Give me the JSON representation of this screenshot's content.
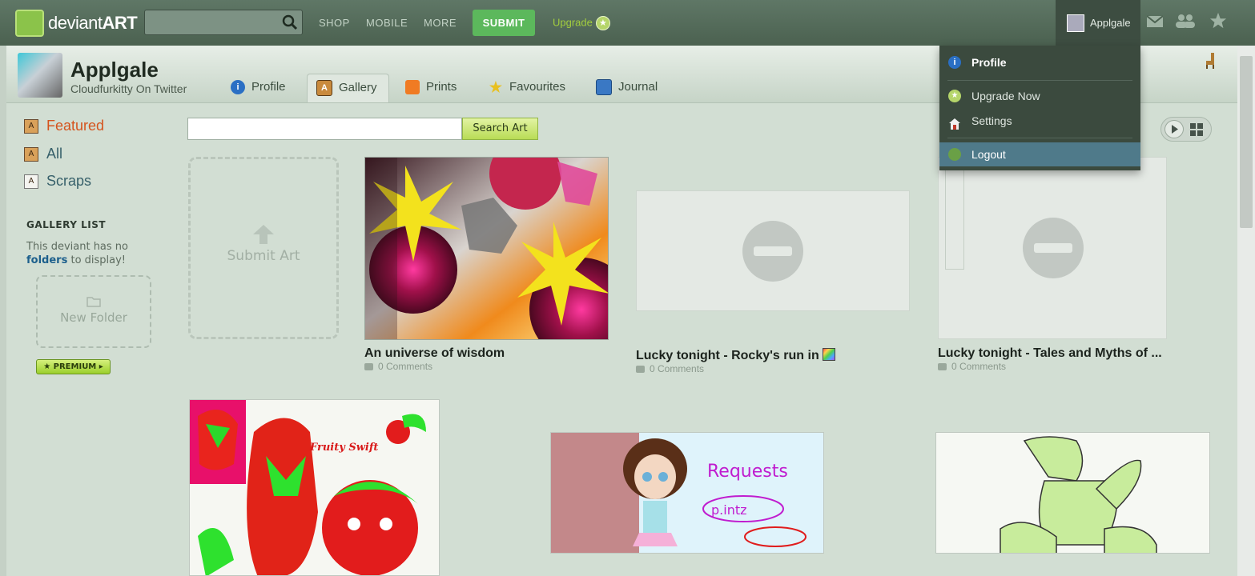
{
  "topbar": {
    "logo_text_a": "deviant",
    "logo_text_b": "ART",
    "search_placeholder": "",
    "nav": [
      "SHOP",
      "MOBILE",
      "MORE"
    ],
    "submit_label": "SUBMIT",
    "upgrade_label": "Upgrade",
    "username": "Applgale"
  },
  "profile": {
    "name": "Applgale",
    "tagline": "Cloudfurkitty On Twitter",
    "tabs": [
      "Profile",
      "Gallery",
      "Prints",
      "Favourites",
      "Journal"
    ],
    "active_tab": "Gallery"
  },
  "sidebar": {
    "links": [
      "Featured",
      "All",
      "Scraps"
    ],
    "gallery_list_title": "GALLERY LIST",
    "folders_msg_a": "This deviant has no",
    "folders_link": "folders",
    "folders_msg_b": "to display!",
    "new_folder_label": "New Folder",
    "premium_label": "PREMIUM"
  },
  "main": {
    "search_button": "Search Art",
    "submit_art_label": "Submit Art",
    "items": [
      {
        "title": "An universe of wisdom",
        "comments": "0 Comments"
      },
      {
        "title": "Lucky tonight - Rocky's run in",
        "comments": "0 Comments"
      },
      {
        "title": "Lucky tonight - Tales and Myths of ...",
        "comments": "0 Comments"
      }
    ]
  },
  "dropdown": {
    "items": [
      "Profile",
      "Upgrade Now",
      "Settings",
      "Logout"
    ]
  },
  "colors": {
    "topbar": "#4f6654",
    "accent_green": "#5cb85c",
    "link_blue": "#1c5f8c"
  }
}
